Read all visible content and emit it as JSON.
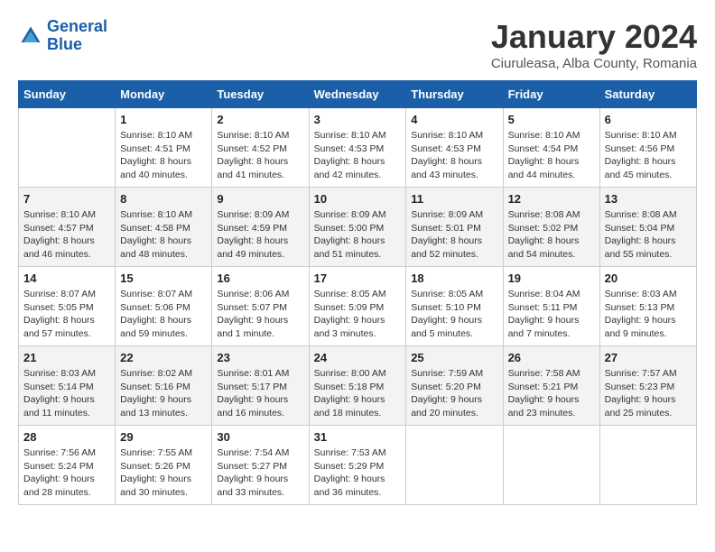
{
  "header": {
    "logo_line1": "General",
    "logo_line2": "Blue",
    "title": "January 2024",
    "subtitle": "Ciuruleasa, Alba County, Romania"
  },
  "days_of_week": [
    "Sunday",
    "Monday",
    "Tuesday",
    "Wednesday",
    "Thursday",
    "Friday",
    "Saturday"
  ],
  "weeks": [
    [
      {
        "num": "",
        "sunrise": "",
        "sunset": "",
        "daylight": ""
      },
      {
        "num": "1",
        "sunrise": "Sunrise: 8:10 AM",
        "sunset": "Sunset: 4:51 PM",
        "daylight": "Daylight: 8 hours and 40 minutes."
      },
      {
        "num": "2",
        "sunrise": "Sunrise: 8:10 AM",
        "sunset": "Sunset: 4:52 PM",
        "daylight": "Daylight: 8 hours and 41 minutes."
      },
      {
        "num": "3",
        "sunrise": "Sunrise: 8:10 AM",
        "sunset": "Sunset: 4:53 PM",
        "daylight": "Daylight: 8 hours and 42 minutes."
      },
      {
        "num": "4",
        "sunrise": "Sunrise: 8:10 AM",
        "sunset": "Sunset: 4:53 PM",
        "daylight": "Daylight: 8 hours and 43 minutes."
      },
      {
        "num": "5",
        "sunrise": "Sunrise: 8:10 AM",
        "sunset": "Sunset: 4:54 PM",
        "daylight": "Daylight: 8 hours and 44 minutes."
      },
      {
        "num": "6",
        "sunrise": "Sunrise: 8:10 AM",
        "sunset": "Sunset: 4:56 PM",
        "daylight": "Daylight: 8 hours and 45 minutes."
      }
    ],
    [
      {
        "num": "7",
        "sunrise": "Sunrise: 8:10 AM",
        "sunset": "Sunset: 4:57 PM",
        "daylight": "Daylight: 8 hours and 46 minutes."
      },
      {
        "num": "8",
        "sunrise": "Sunrise: 8:10 AM",
        "sunset": "Sunset: 4:58 PM",
        "daylight": "Daylight: 8 hours and 48 minutes."
      },
      {
        "num": "9",
        "sunrise": "Sunrise: 8:09 AM",
        "sunset": "Sunset: 4:59 PM",
        "daylight": "Daylight: 8 hours and 49 minutes."
      },
      {
        "num": "10",
        "sunrise": "Sunrise: 8:09 AM",
        "sunset": "Sunset: 5:00 PM",
        "daylight": "Daylight: 8 hours and 51 minutes."
      },
      {
        "num": "11",
        "sunrise": "Sunrise: 8:09 AM",
        "sunset": "Sunset: 5:01 PM",
        "daylight": "Daylight: 8 hours and 52 minutes."
      },
      {
        "num": "12",
        "sunrise": "Sunrise: 8:08 AM",
        "sunset": "Sunset: 5:02 PM",
        "daylight": "Daylight: 8 hours and 54 minutes."
      },
      {
        "num": "13",
        "sunrise": "Sunrise: 8:08 AM",
        "sunset": "Sunset: 5:04 PM",
        "daylight": "Daylight: 8 hours and 55 minutes."
      }
    ],
    [
      {
        "num": "14",
        "sunrise": "Sunrise: 8:07 AM",
        "sunset": "Sunset: 5:05 PM",
        "daylight": "Daylight: 8 hours and 57 minutes."
      },
      {
        "num": "15",
        "sunrise": "Sunrise: 8:07 AM",
        "sunset": "Sunset: 5:06 PM",
        "daylight": "Daylight: 8 hours and 59 minutes."
      },
      {
        "num": "16",
        "sunrise": "Sunrise: 8:06 AM",
        "sunset": "Sunset: 5:07 PM",
        "daylight": "Daylight: 9 hours and 1 minute."
      },
      {
        "num": "17",
        "sunrise": "Sunrise: 8:05 AM",
        "sunset": "Sunset: 5:09 PM",
        "daylight": "Daylight: 9 hours and 3 minutes."
      },
      {
        "num": "18",
        "sunrise": "Sunrise: 8:05 AM",
        "sunset": "Sunset: 5:10 PM",
        "daylight": "Daylight: 9 hours and 5 minutes."
      },
      {
        "num": "19",
        "sunrise": "Sunrise: 8:04 AM",
        "sunset": "Sunset: 5:11 PM",
        "daylight": "Daylight: 9 hours and 7 minutes."
      },
      {
        "num": "20",
        "sunrise": "Sunrise: 8:03 AM",
        "sunset": "Sunset: 5:13 PM",
        "daylight": "Daylight: 9 hours and 9 minutes."
      }
    ],
    [
      {
        "num": "21",
        "sunrise": "Sunrise: 8:03 AM",
        "sunset": "Sunset: 5:14 PM",
        "daylight": "Daylight: 9 hours and 11 minutes."
      },
      {
        "num": "22",
        "sunrise": "Sunrise: 8:02 AM",
        "sunset": "Sunset: 5:16 PM",
        "daylight": "Daylight: 9 hours and 13 minutes."
      },
      {
        "num": "23",
        "sunrise": "Sunrise: 8:01 AM",
        "sunset": "Sunset: 5:17 PM",
        "daylight": "Daylight: 9 hours and 16 minutes."
      },
      {
        "num": "24",
        "sunrise": "Sunrise: 8:00 AM",
        "sunset": "Sunset: 5:18 PM",
        "daylight": "Daylight: 9 hours and 18 minutes."
      },
      {
        "num": "25",
        "sunrise": "Sunrise: 7:59 AM",
        "sunset": "Sunset: 5:20 PM",
        "daylight": "Daylight: 9 hours and 20 minutes."
      },
      {
        "num": "26",
        "sunrise": "Sunrise: 7:58 AM",
        "sunset": "Sunset: 5:21 PM",
        "daylight": "Daylight: 9 hours and 23 minutes."
      },
      {
        "num": "27",
        "sunrise": "Sunrise: 7:57 AM",
        "sunset": "Sunset: 5:23 PM",
        "daylight": "Daylight: 9 hours and 25 minutes."
      }
    ],
    [
      {
        "num": "28",
        "sunrise": "Sunrise: 7:56 AM",
        "sunset": "Sunset: 5:24 PM",
        "daylight": "Daylight: 9 hours and 28 minutes."
      },
      {
        "num": "29",
        "sunrise": "Sunrise: 7:55 AM",
        "sunset": "Sunset: 5:26 PM",
        "daylight": "Daylight: 9 hours and 30 minutes."
      },
      {
        "num": "30",
        "sunrise": "Sunrise: 7:54 AM",
        "sunset": "Sunset: 5:27 PM",
        "daylight": "Daylight: 9 hours and 33 minutes."
      },
      {
        "num": "31",
        "sunrise": "Sunrise: 7:53 AM",
        "sunset": "Sunset: 5:29 PM",
        "daylight": "Daylight: 9 hours and 36 minutes."
      },
      {
        "num": "",
        "sunrise": "",
        "sunset": "",
        "daylight": ""
      },
      {
        "num": "",
        "sunrise": "",
        "sunset": "",
        "daylight": ""
      },
      {
        "num": "",
        "sunrise": "",
        "sunset": "",
        "daylight": ""
      }
    ]
  ]
}
